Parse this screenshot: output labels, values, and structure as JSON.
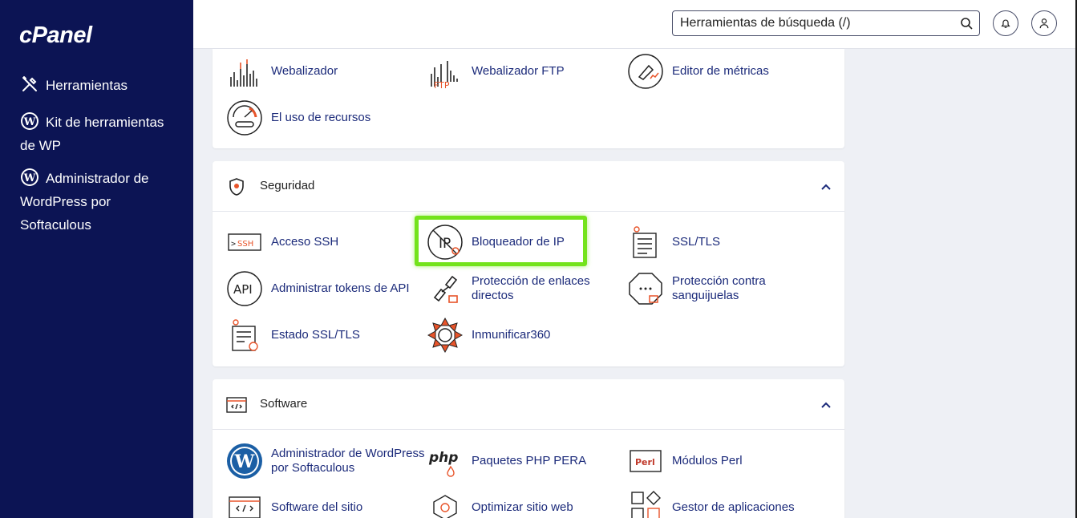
{
  "sidebar": {
    "logo": "cPanel",
    "items": [
      {
        "label": "Herramientas",
        "icon": "tools-icon"
      },
      {
        "label": "Kit de herramientas de WP",
        "icon": "wordpress-icon"
      },
      {
        "label": "Administrador de WordPress por Softaculous",
        "icon": "wordpress-icon"
      }
    ]
  },
  "header": {
    "search_placeholder": "Herramientas de búsqueda (/)",
    "icons": [
      "search-icon",
      "bell-icon",
      "user-icon"
    ]
  },
  "metrics": {
    "items": [
      {
        "label": "Webalizador",
        "icon": "webalizer-icon"
      },
      {
        "label": "Webalizador FTP",
        "icon": "webalizer-ftp-icon"
      },
      {
        "label": "Editor de métricas",
        "icon": "metrics-editor-icon"
      },
      {
        "label": "El uso de recursos",
        "icon": "resource-usage-icon"
      }
    ]
  },
  "security": {
    "title": "Seguridad",
    "items": [
      {
        "label": "Acceso SSH",
        "icon": "ssh-icon"
      },
      {
        "label": "Bloqueador de IP",
        "icon": "ip-blocker-icon"
      },
      {
        "label": "SSL/TLS",
        "icon": "ssl-tls-icon"
      },
      {
        "label": "Administrar tokens de API",
        "icon": "api-icon"
      },
      {
        "label": "Protección de enlaces directos",
        "icon": "hotlink-icon"
      },
      {
        "label": "Protección contra sanguijuelas",
        "icon": "leech-icon"
      },
      {
        "label": "Estado SSL/TLS",
        "icon": "ssl-status-icon"
      },
      {
        "label": "Inmunificar360",
        "icon": "imunify-icon"
      }
    ]
  },
  "software": {
    "title": "Software",
    "items": [
      {
        "label": "Administrador de WordPress por Softaculous",
        "icon": "wordpress-icon"
      },
      {
        "label": "Paquetes PHP PERA",
        "icon": "php-icon",
        "icon_text": "php"
      },
      {
        "label": "Módulos Perl",
        "icon": "perl-icon",
        "icon_text": "Perl"
      },
      {
        "label": "Software del sitio",
        "icon": "site-software-icon"
      },
      {
        "label": "Optimizar sitio web",
        "icon": "optimize-icon"
      },
      {
        "label": "Gestor de aplicaciones",
        "icon": "app-manager-icon"
      }
    ]
  },
  "colors": {
    "sidebar_bg": "#0c1454",
    "link": "#1b2a7a",
    "accent_orange": "#e8542a",
    "highlight": "#74e31c"
  }
}
